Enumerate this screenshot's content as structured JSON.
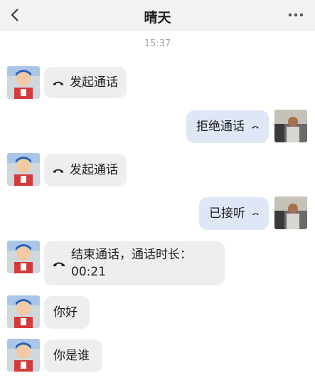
{
  "header": {
    "title": "晴天",
    "back_icon": "chevron-left-icon",
    "more_icon": "ellipsis-icon"
  },
  "timestamp": "15:37",
  "messages": [
    {
      "side": "in",
      "icon": "phone-icon",
      "text": "发起通话"
    },
    {
      "side": "out",
      "icon": "phone-icon",
      "text": "拒绝通话"
    },
    {
      "side": "in",
      "icon": "phone-icon",
      "text": "发起通话"
    },
    {
      "side": "out",
      "icon": "phone-icon",
      "text": "已接听"
    },
    {
      "side": "in",
      "icon": "phone-icon",
      "text": "结束通话，通话时长：",
      "text2": "00:21"
    },
    {
      "side": "in",
      "text": "你好"
    },
    {
      "side": "in",
      "text": "你是谁"
    }
  ],
  "colors": {
    "header_bg": "#f1f2f4",
    "incoming_bubble": "#eeeeee",
    "outgoing_bubble": "#dfe7f7"
  }
}
